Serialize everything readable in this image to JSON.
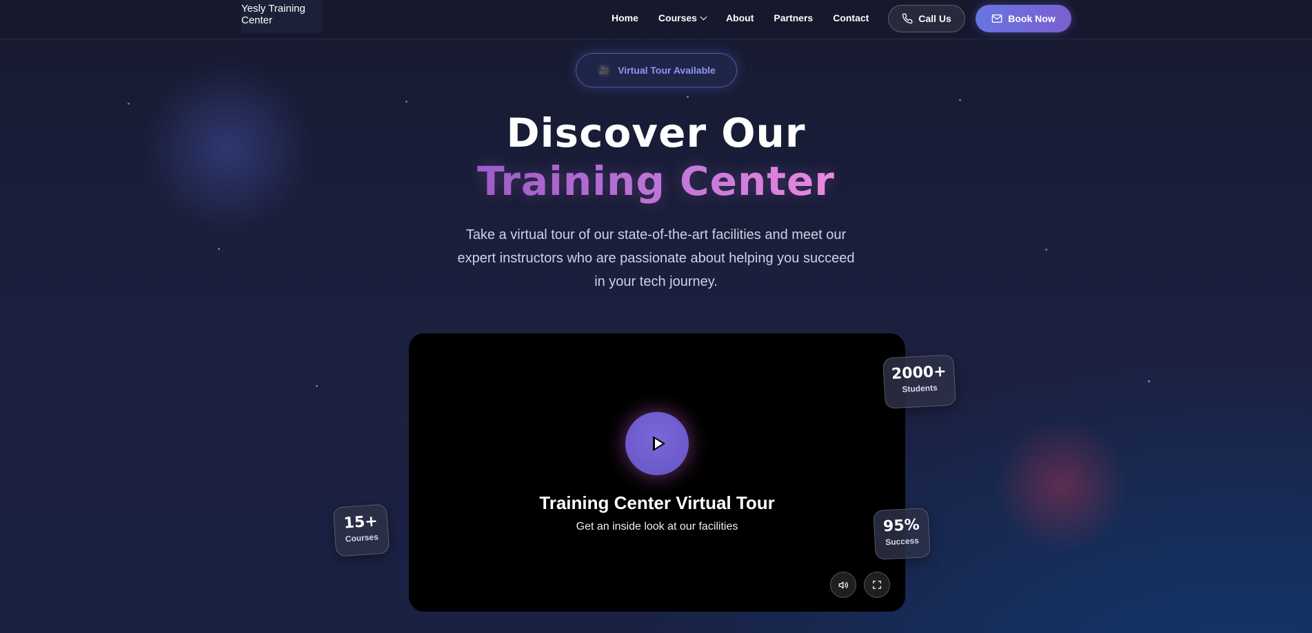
{
  "header": {
    "logo_alt": "Yesly Training Center",
    "nav": [
      {
        "label": "Home"
      },
      {
        "label": "Courses",
        "has_dropdown": true
      },
      {
        "label": "About"
      },
      {
        "label": "Partners"
      },
      {
        "label": "Contact"
      }
    ],
    "call_label": "Call Us",
    "book_label": "Book Now"
  },
  "hero": {
    "badge_icon": "🎥",
    "badge": "Virtual Tour Available",
    "title_line1": "Discover Our",
    "title_line2": "Training Center",
    "lead": "Take a virtual tour of our state-of-the-art facilities and meet our expert instructors who are passionate about helping you succeed in your tech journey."
  },
  "video": {
    "title": "Training Center Virtual Tour",
    "subtitle": "Get an inside look at our facilities",
    "controls": [
      "volume-icon",
      "fullscreen-icon"
    ]
  },
  "stats": {
    "students": {
      "value": "2000+",
      "label": "Students"
    },
    "courses": {
      "value": "15+",
      "label": "Courses"
    },
    "success": {
      "value": "95%",
      "label": "Success"
    }
  },
  "colors": {
    "accent": "#6875e0",
    "gradient_title_start": "#9a5bc6",
    "gradient_title_end": "#f08ce0",
    "badge_text": "#8c98f2"
  }
}
